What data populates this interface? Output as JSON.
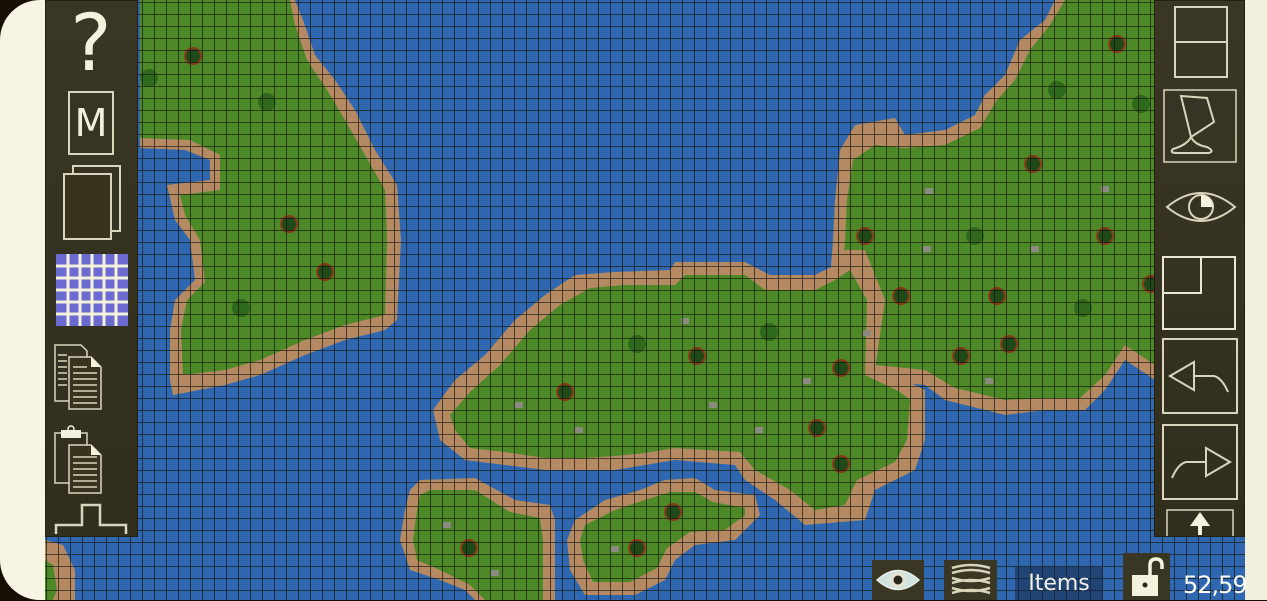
{
  "app": {
    "type": "tile-map-editor"
  },
  "left_toolbar": {
    "items": [
      {
        "name": "help",
        "label": "?",
        "icon": "question-icon"
      },
      {
        "name": "map-menu",
        "label": "M",
        "icon": "m-box-icon"
      },
      {
        "name": "layers-pages",
        "icon": "stacked-pages-icon"
      },
      {
        "name": "grid-toggle",
        "icon": "grid-icon",
        "active": true
      },
      {
        "name": "copy",
        "icon": "copy-documents-icon"
      },
      {
        "name": "paste",
        "icon": "clipboard-paste-icon"
      },
      {
        "name": "raise-terrain",
        "icon": "raise-step-icon"
      }
    ]
  },
  "right_toolbar": {
    "items": [
      {
        "name": "split-horizontal",
        "icon": "split-horizontal-icon"
      },
      {
        "name": "fill-bucket",
        "icon": "bucket-icon"
      },
      {
        "name": "visibility",
        "icon": "eye-icon"
      },
      {
        "name": "select-corner",
        "icon": "corner-select-icon"
      },
      {
        "name": "undo",
        "icon": "undo-arrow-icon"
      },
      {
        "name": "redo",
        "icon": "redo-arrow-icon"
      },
      {
        "name": "scroll-up",
        "icon": "up-arrow-icon"
      }
    ]
  },
  "bottom_bar": {
    "view_toggle_icon": "eye-icon",
    "layers_icon": "layers-stack-icon",
    "items_label": "Items",
    "lock_icon": "unlocked-padlock-icon",
    "coordinates": "52,59"
  },
  "colors": {
    "water": "#2f68b0",
    "grass": "#4d8a27",
    "sand": "#b58a63",
    "panel": "#37331f",
    "icon_stroke": "#d9d5bd",
    "grid_line": "#14130a",
    "grid_active": "#6b6ad0"
  }
}
